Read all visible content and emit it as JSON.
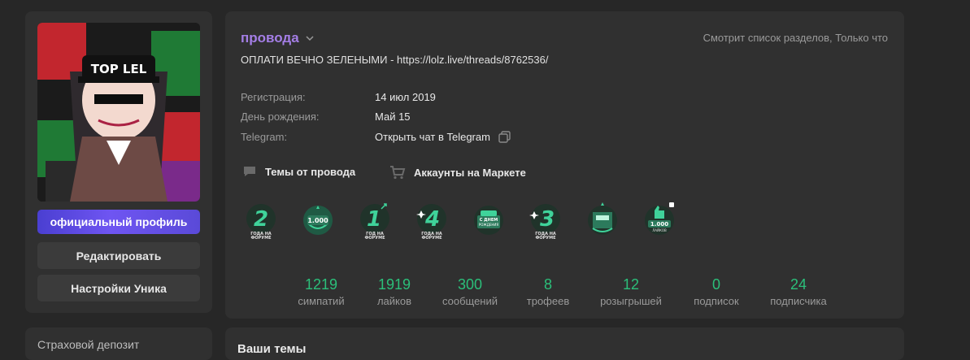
{
  "profile": {
    "avatar_text": "TOP LEL",
    "official_label": "официальный профиль",
    "edit_label": "Редактировать",
    "settings_label": "Настройки Уника"
  },
  "user": {
    "name": "провода",
    "status": "ОПЛАТИ ВЕЧНО ЗЕЛЕНЫМИ - https://lolz.live/threads/8762536/",
    "activity": "Смотрит список разделов, Только что"
  },
  "info": {
    "registration_label": "Регистрация:",
    "registration_value": "14 июл 2019",
    "birthday_label": "День рождения:",
    "birthday_value": "Май 15",
    "telegram_label": "Telegram:",
    "telegram_value": "Открыть чат в Telegram"
  },
  "links": {
    "threads": "Темы от провода",
    "market": "Аккаунты на Маркете"
  },
  "badges": [
    {
      "id": "2-years",
      "digit": "2",
      "caption": "ГОДА НА ФОРУМЕ"
    },
    {
      "id": "1000-likes",
      "digit": "1.000",
      "caption": ""
    },
    {
      "id": "1-year",
      "digit": "1",
      "caption": "ГОД НА ФОРУМЕ"
    },
    {
      "id": "4-years",
      "digit": "4",
      "caption": "ГОДА НА ФОРУМЕ"
    },
    {
      "id": "birthday",
      "digit": "",
      "caption": "С ДНЕМ РОЖДЕНИЯ"
    },
    {
      "id": "3-years",
      "digit": "3",
      "caption": "ГОДА НА ФОРУМЕ"
    },
    {
      "id": "contest",
      "digit": "",
      "caption": ""
    },
    {
      "id": "1000-likes-2",
      "digit": "1.000",
      "caption": "ЛАЙКОВ"
    }
  ],
  "stats": [
    {
      "value": "1219",
      "label": "симпатий"
    },
    {
      "value": "1919",
      "label": "лайков"
    },
    {
      "value": "300",
      "label": "сообщений"
    },
    {
      "value": "8",
      "label": "трофеев"
    },
    {
      "value": "12",
      "label": "розыгрышей"
    },
    {
      "value": "0",
      "label": "подписок"
    },
    {
      "value": "24",
      "label": "подписчика"
    }
  ],
  "sidebar": {
    "deposit_title": "Страховой депозит"
  },
  "topics": {
    "title": "Ваши темы"
  },
  "colors": {
    "accent_green": "#2bbf7a",
    "username_purple": "#a47ee6",
    "official_gradient_start": "#4a3fd1"
  }
}
